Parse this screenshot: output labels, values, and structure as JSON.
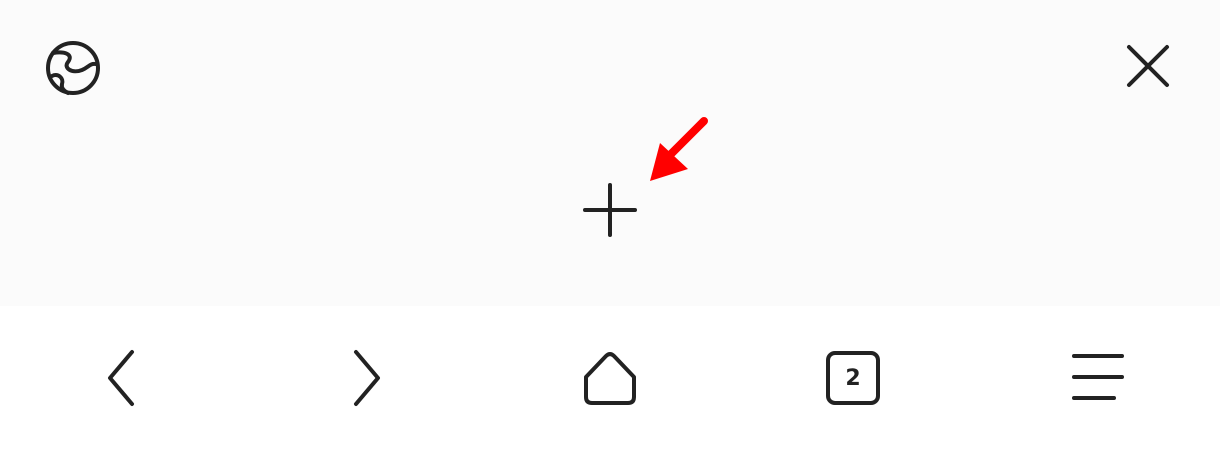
{
  "panel": {
    "globe_icon": "globe-icon",
    "close_icon": "close-icon",
    "new_tab_icon": "plus-icon",
    "annotation": {
      "icon": "red-arrow-icon",
      "color": "#ff0000"
    }
  },
  "toolbar": {
    "back_icon": "chevron-left-icon",
    "forward_icon": "chevron-right-icon",
    "home_icon": "home-icon",
    "tabs_icon": "tabs-counter-icon",
    "tab_count": "2",
    "menu_icon": "hamburger-menu-icon"
  },
  "colors": {
    "panel_background": "#fbfbfb",
    "toolbar_background": "#ffffff",
    "icon": "#222222"
  }
}
